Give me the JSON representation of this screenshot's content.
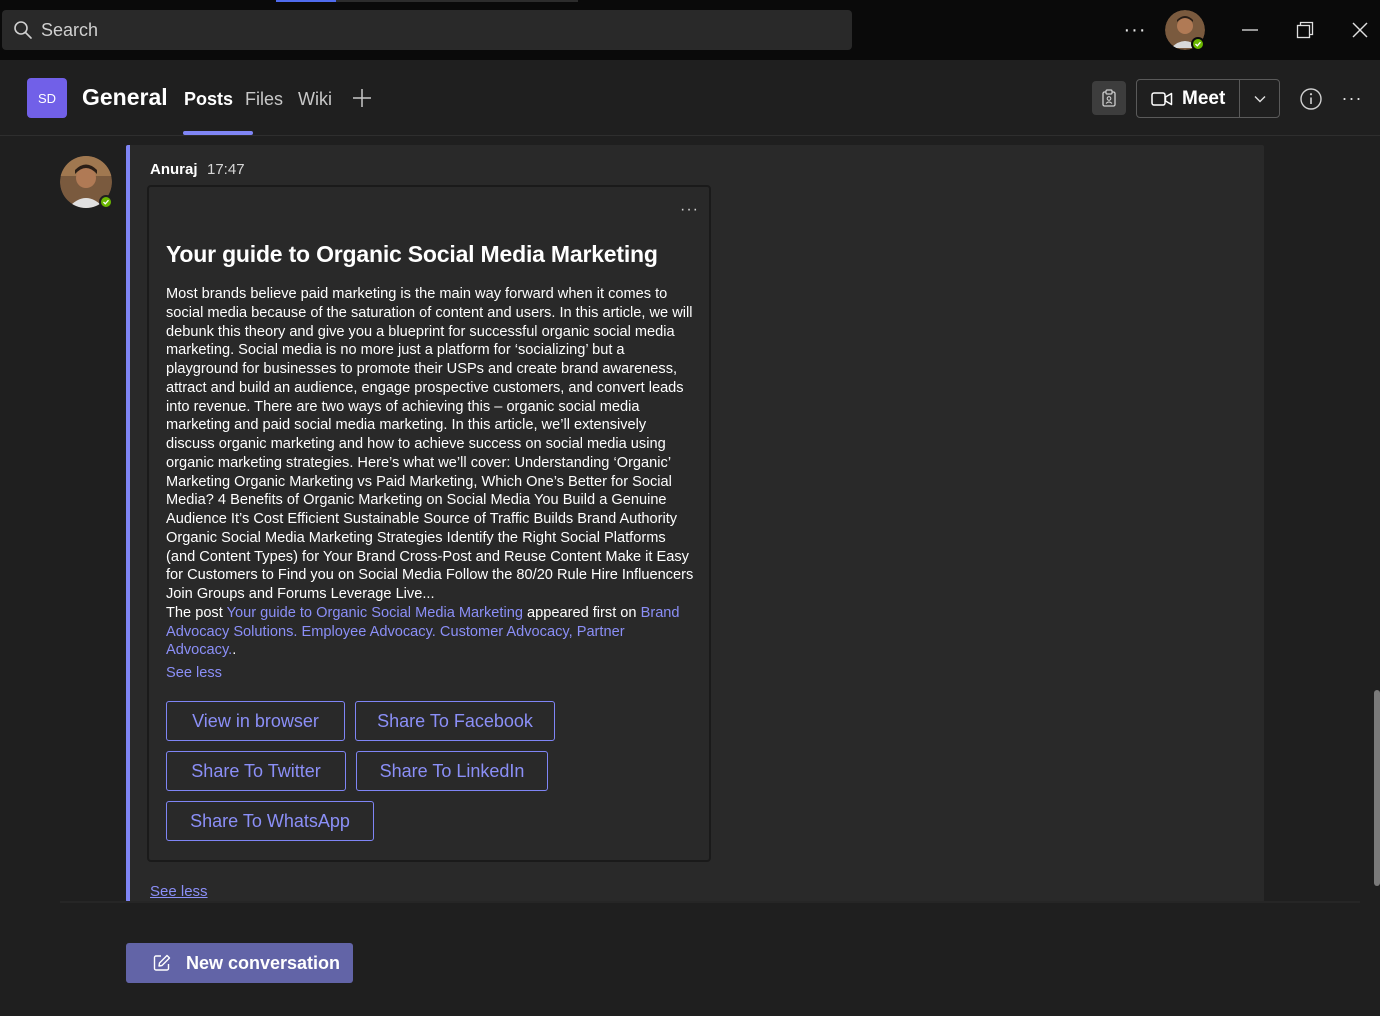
{
  "titlebar": {
    "search_placeholder": "Search",
    "more_label": "···"
  },
  "channel": {
    "team_initials": "SD",
    "name": "General",
    "tabs": [
      {
        "label": "Posts",
        "active": true
      },
      {
        "label": "Files",
        "active": false
      },
      {
        "label": "Wiki",
        "active": false
      }
    ],
    "meet_label": "Meet",
    "more_label": "···",
    "accent_color": "#7f85f5"
  },
  "message": {
    "author": "Anuraj",
    "time": "17:47",
    "card": {
      "more_label": "···",
      "title": "Your guide to Organic Social Media Marketing",
      "body": "Most brands believe paid marketing is the main way forward when it comes to social media because of the saturation of content and users. In this article, we will debunk this theory and give you a blueprint for successful organic social media marketing. Social media is no more just a platform for ‘socializing’ but a playground for businesses to promote their USPs and create brand awareness, attract and build an audience, engage prospective customers, and convert leads into revenue. There are two ways of achieving this – organic social media marketing and paid social media marketing. In this article, we’ll extensively discuss organic marketing and how to achieve success on social media using organic marketing strategies. Here’s what we’ll cover: Understanding ‘Organic’ Marketing Organic Marketing vs Paid Marketing, Which One’s Better for Social Media? 4 Benefits of Organic Marketing on Social Media You Build a Genuine Audience It’s Cost Efficient Sustainable Source of Traffic Builds Brand Authority Organic Social Media Marketing Strategies Identify the Right Social Platforms (and Content Types) for Your Brand Cross-Post and Reuse Content Make it Easy for Customers to Find you on Social Media Follow the 80/20 Rule Hire Influencers Join Groups and Forums Leverage Live...",
      "post_prefix": "The post ",
      "post_link": "Your guide to Organic Social Media Marketing",
      "post_middle": " appeared first on ",
      "site_link": "Brand Advocacy Solutions. Employee Advocacy. Customer Advocacy, Partner Advocacy.",
      "post_suffix": ".",
      "see_less": "See less",
      "buttons": {
        "view_in_browser": "View in browser",
        "share_facebook": "Share To Facebook",
        "share_twitter": "Share To Twitter",
        "share_linkedin": "Share To LinkedIn",
        "share_whatsapp": "Share To WhatsApp"
      }
    },
    "see_less": "See less"
  },
  "composer": {
    "new_conversation_label": "New conversation"
  }
}
